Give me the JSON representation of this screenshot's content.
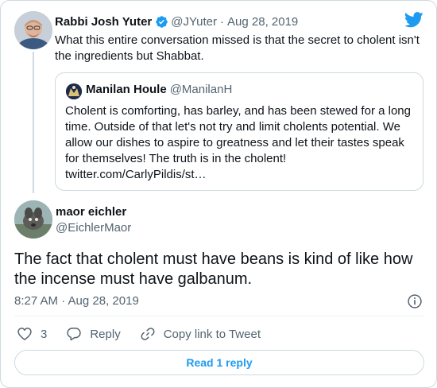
{
  "parent_tweet": {
    "author_name": "Rabbi Josh Yuter",
    "author_handle": "@JYuter",
    "date": "Aug 28, 2019",
    "separator": "·",
    "text": "What this entire conversation missed is that the secret to cholent isn't the ingredients but Shabbat.",
    "quote": {
      "author_name": "Manilan Houle",
      "author_handle": "@ManilanH",
      "text": "Cholent is comforting, has barley, and has been stewed for a long time. Outside of that let's not try and limit cholents potential. We allow our dishes to aspire to greatness and let their tastes speak for themselves! The truth is in the cholent!",
      "link": "twitter.com/CarlyPildis/st…"
    }
  },
  "main_tweet": {
    "author_name": "maor eichler",
    "author_handle": "@EichlerMaor",
    "text": "The fact that cholent must have beans is kind of like how the incense must have galbanum.",
    "timestamp": "8:27 AM · Aug 28, 2019"
  },
  "actions": {
    "like_count": "3",
    "reply_label": "Reply",
    "copy_link_label": "Copy link to Tweet"
  },
  "read_replies_label": "Read 1 reply",
  "icons": {
    "verified": "verified-badge-icon",
    "brand": "twitter-bird-icon",
    "info": "info-icon",
    "like": "heart-icon",
    "reply": "speech-bubble-icon",
    "copy_link": "link-icon"
  },
  "colors": {
    "brand_blue": "#1d9bf0",
    "text_primary": "#0f1419",
    "text_secondary": "#536471",
    "border": "#cfd9de"
  }
}
